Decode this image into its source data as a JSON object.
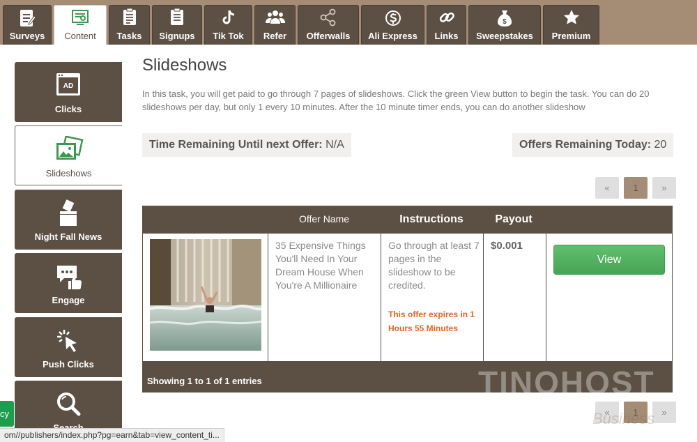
{
  "top_tabs": [
    {
      "label": "Surveys",
      "icon": "clipboard-icon"
    },
    {
      "label": "Content",
      "icon": "monitor-icon",
      "active": true
    },
    {
      "label": "Tasks",
      "icon": "checklist-icon"
    },
    {
      "label": "Signups",
      "icon": "form-icon"
    },
    {
      "label": "Tik Tok",
      "icon": "tiktok-icon"
    },
    {
      "label": "Refer",
      "icon": "users-icon"
    },
    {
      "label": "Offerwalls",
      "icon": "share-icon"
    },
    {
      "label": "Ali Express",
      "icon": "dollar-circle-icon"
    },
    {
      "label": "Links",
      "icon": "link-icon"
    },
    {
      "label": "Sweepstakes",
      "icon": "money-bag-icon"
    },
    {
      "label": "Premium",
      "icon": "star-icon"
    }
  ],
  "sidebar": {
    "items": [
      {
        "label": "Clicks",
        "icon": "ad-window-icon"
      },
      {
        "label": "Slideshows",
        "icon": "photos-icon",
        "active": true
      },
      {
        "label": "Night Fall News",
        "icon": "ballot-box-icon"
      },
      {
        "label": "Engage",
        "icon": "chat-like-icon"
      },
      {
        "label": "Push Clicks",
        "icon": "cursor-click-icon"
      },
      {
        "label": "Search",
        "icon": "magnifier-icon"
      }
    ]
  },
  "main": {
    "title": "Slideshows",
    "intro": "In this task, you will get paid to go through 7 pages of slideshows. Click the green View button to begin the task. You can do 20 slideshows per day, but only 1 every 10 minutes. After the 10 minute timer ends, you can do another slideshow",
    "time_remaining_label": "Time Remaining Until next Offer:",
    "time_remaining_value": "N/A",
    "offers_remaining_label": "Offers Remaining Today:",
    "offers_remaining_value": "20",
    "pager": {
      "prev": "«",
      "page": "1",
      "next": "»"
    },
    "table": {
      "columns": [
        "",
        "Offer Name",
        "Instructions",
        "Payout",
        ""
      ],
      "rows": [
        {
          "offer_name": "35 Expensive Things You'll Need In Your Dream House When You're A Millionaire",
          "instructions": "Go through at least 7 pages in the slideshow to be credited.",
          "expiry": "This offer expires in 1 Hours 55 Minutes",
          "payout": "$0.001",
          "action": "View"
        }
      ],
      "footer": "Showing 1 to 1 of 1 entries"
    }
  },
  "watermark": {
    "text": "TINOHOST",
    "sub": "Business"
  },
  "status_bar": {
    "url": "om//publishers/index.php?pg=earn&tab=view_content_ti..."
  },
  "privacy_tab": {
    "label": "cy"
  },
  "colors": {
    "brand_brown": "#5c4f43",
    "tan": "#a58c75",
    "view_green": "#4dac5c",
    "expiry_orange": "#e4661f"
  }
}
